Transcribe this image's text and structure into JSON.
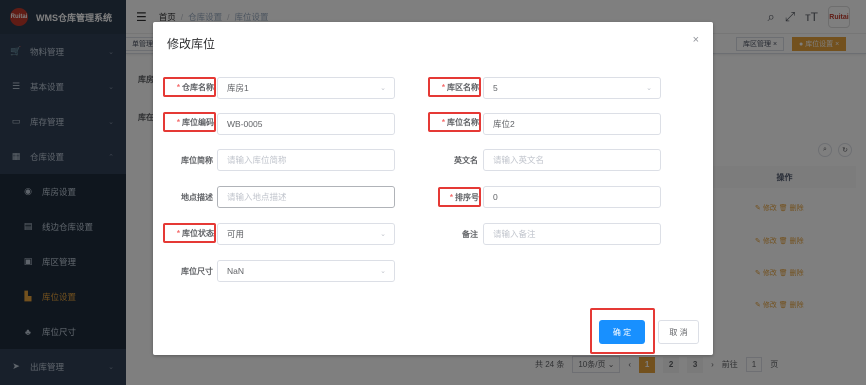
{
  "app": {
    "title": "WMS仓库管理系统",
    "logo_text": "Ruitai"
  },
  "sidebar": {
    "items": [
      {
        "label": "物料管理",
        "icon": "cart-icon"
      },
      {
        "label": "基本设置",
        "icon": "settings-icon"
      },
      {
        "label": "库存管理",
        "icon": "monitor-icon"
      },
      {
        "label": "仓库设置",
        "icon": "building-icon"
      }
    ],
    "sub_items": [
      {
        "label": "库房设置"
      },
      {
        "label": "线边仓库设置"
      },
      {
        "label": "库区管理"
      },
      {
        "label": "库位设置"
      },
      {
        "label": "库位尺寸"
      }
    ],
    "bottom_item": {
      "label": "出库管理"
    }
  },
  "header": {
    "breadcrumb": [
      "首页",
      "仓库设置",
      "库位设置"
    ],
    "avatar_text": "Ruitai"
  },
  "tags": {
    "left_partial": "单管理",
    "items": [
      "库区管理",
      "库位设置"
    ]
  },
  "background": {
    "label_1": "库房",
    "label_2": "库在",
    "table_header_op": "操作",
    "row_edit": "修改",
    "row_delete": "删除",
    "pagination": {
      "total": "共 24 条",
      "page_size": "10条/页",
      "pages": [
        "1",
        "2",
        "3"
      ],
      "goto_label": "前往",
      "goto_value": "1",
      "page_suffix": "页"
    }
  },
  "dialog": {
    "title": "修改库位",
    "fields": {
      "warehouse_name": {
        "label": "仓库名称",
        "value": "库房1"
      },
      "area_name": {
        "label": "库区名称",
        "value": "5"
      },
      "location_code": {
        "label": "库位编码",
        "value": "WB-0005"
      },
      "location_name": {
        "label": "库位名称",
        "value": "库位2"
      },
      "short_name": {
        "label": "库位简称",
        "placeholder": "请输入库位简称"
      },
      "english_name": {
        "label": "英文名",
        "placeholder": "请输入英文名"
      },
      "location_desc": {
        "label": "地点描述",
        "placeholder": "请输入地点描述"
      },
      "sort_no": {
        "label": "排序号",
        "value": "0"
      },
      "status": {
        "label": "库位状态",
        "value": "可用"
      },
      "remark": {
        "label": "备注",
        "placeholder": "请输入备注"
      },
      "size": {
        "label": "库位尺寸",
        "value": "NaN"
      }
    },
    "confirm_label": "确 定",
    "cancel_label": "取 消"
  },
  "colors": {
    "sidebar_bg": "#304156",
    "accent": "#e6a23c",
    "primary": "#1890ff",
    "highlight": "#e53935"
  }
}
